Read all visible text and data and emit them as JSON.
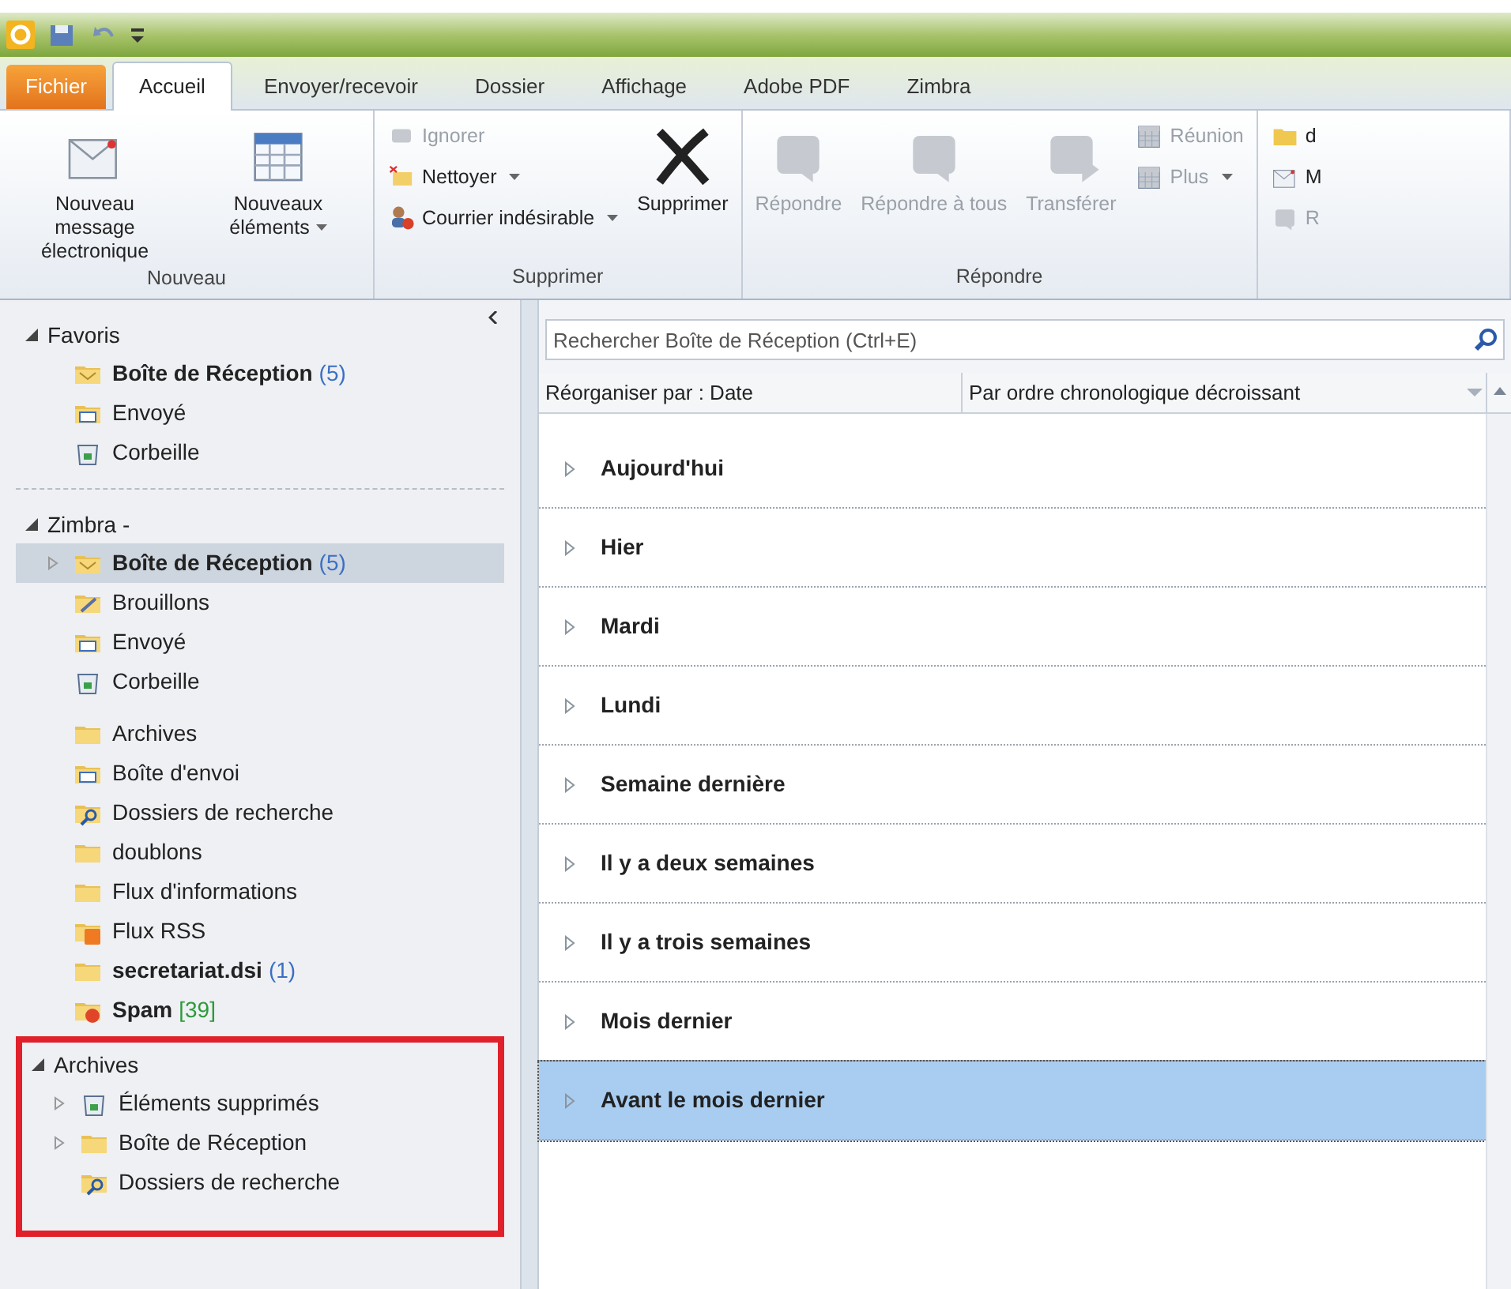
{
  "tabs": [
    {
      "label": "Fichier",
      "kind": "file",
      "selected": false
    },
    {
      "label": "Accueil",
      "kind": "tab",
      "selected": true
    },
    {
      "label": "Envoyer/recevoir",
      "kind": "tab",
      "selected": false
    },
    {
      "label": "Dossier",
      "kind": "tab",
      "selected": false
    },
    {
      "label": "Affichage",
      "kind": "tab",
      "selected": false
    },
    {
      "label": "Adobe PDF",
      "kind": "tab",
      "selected": false
    },
    {
      "label": "Zimbra",
      "kind": "tab",
      "selected": false
    }
  ],
  "ribbon": [
    {
      "label": "Nouveau",
      "buttons": [
        {
          "label": "Nouveau message électronique",
          "kind": "large",
          "disabled": false,
          "dropdown": false
        },
        {
          "label": "Nouveaux éléments",
          "kind": "large",
          "disabled": false,
          "dropdown": true
        }
      ]
    },
    {
      "label": "Supprimer",
      "buttons": [
        {
          "label": "Ignorer",
          "kind": "small",
          "disabled": true,
          "dropdown": false
        },
        {
          "label": "Nettoyer",
          "kind": "small",
          "disabled": false,
          "dropdown": true
        },
        {
          "label": "Courrier indésirable",
          "kind": "small",
          "disabled": false,
          "dropdown": true
        },
        {
          "label": "Supprimer",
          "kind": "large",
          "disabled": false,
          "dropdown": false
        }
      ]
    },
    {
      "label": "Répondre",
      "buttons": [
        {
          "label": "Répondre",
          "kind": "large",
          "disabled": true,
          "dropdown": false
        },
        {
          "label": "Répondre à tous",
          "kind": "large",
          "disabled": true,
          "dropdown": false
        },
        {
          "label": "Transférer",
          "kind": "large",
          "disabled": true,
          "dropdown": false
        },
        {
          "label": "Réunion",
          "kind": "small",
          "disabled": true,
          "dropdown": false
        },
        {
          "label": "Plus",
          "kind": "small",
          "disabled": true,
          "dropdown": true
        }
      ]
    },
    {
      "buttons": [
        {
          "label": "d",
          "kind": "small",
          "disabled": false,
          "dropdown": false
        },
        {
          "label": "M",
          "kind": "small",
          "disabled": false,
          "dropdown": false
        },
        {
          "label": "R",
          "kind": "small",
          "disabled": true,
          "dropdown": false
        }
      ]
    }
  ],
  "folder_sections": [
    {
      "title": "Favoris",
      "highlighted": false,
      "items": [
        {
          "name": "Boîte de Réception",
          "count": "(5)",
          "color": "#3b6fc4",
          "kind": "inbox",
          "bold": true,
          "selected": false
        },
        {
          "name": "Envoyé",
          "kind": "sent",
          "bold": false,
          "selected": false
        },
        {
          "name": "Corbeille",
          "kind": "trash",
          "bold": false,
          "selected": false
        }
      ]
    },
    {
      "title": "Zimbra -",
      "highlighted": false,
      "items": [
        {
          "name": "Boîte de Réception",
          "count": "(5)",
          "color": "#3b6fc4",
          "kind": "inbox",
          "bold": true,
          "selected": true,
          "expanded": false
        },
        {
          "name": "Brouillons",
          "kind": "drafts",
          "bold": false,
          "selected": false
        },
        {
          "name": "Envoyé",
          "kind": "sent",
          "bold": false,
          "selected": false
        },
        {
          "name": "Corbeille",
          "kind": "trash",
          "bold": false,
          "selected": false
        },
        {
          "name": "Archives",
          "kind": "folder",
          "bold": false,
          "selected": false
        },
        {
          "name": "Boîte d'envoi",
          "kind": "outbox",
          "bold": false,
          "selected": false
        },
        {
          "name": "Dossiers de recherche",
          "kind": "search",
          "bold": false,
          "selected": false
        },
        {
          "name": "doublons",
          "kind": "folder",
          "bold": false,
          "selected": false
        },
        {
          "name": "Flux d'informations",
          "kind": "folder",
          "bold": false,
          "selected": false
        },
        {
          "name": "Flux RSS",
          "kind": "rss",
          "bold": false,
          "selected": false
        },
        {
          "name": "secretariat.dsi",
          "count": "(1)",
          "color": "#3b6fc4",
          "kind": "folder",
          "bold": true,
          "selected": false
        },
        {
          "name": "Spam",
          "count": "[39]",
          "color": "#2e9a3a",
          "kind": "spam",
          "bold": true,
          "selected": false
        }
      ]
    },
    {
      "title": "Archives",
      "highlighted": true,
      "items": [
        {
          "name": "Éléments supprimés",
          "kind": "trash",
          "bold": false,
          "selected": false,
          "expanded": false
        },
        {
          "name": "Boîte de Réception",
          "kind": "folder",
          "bold": false,
          "selected": false,
          "expanded": false
        },
        {
          "name": "Dossiers de recherche",
          "kind": "search",
          "bold": false,
          "selected": false
        }
      ]
    }
  ],
  "search": {
    "placeholder": "Rechercher Boîte de Réception (Ctrl+E)"
  },
  "arrange": {
    "sort_by": "Réorganiser par : Date",
    "order": "Par ordre chronologique décroissant"
  },
  "mail_groups": [
    {
      "label": "Aujourd'hui",
      "selected": false
    },
    {
      "label": "Hier",
      "selected": false
    },
    {
      "label": "Mardi",
      "selected": false
    },
    {
      "label": "Lundi",
      "selected": false
    },
    {
      "label": "Semaine dernière",
      "selected": false
    },
    {
      "label": "Il y a deux semaines",
      "selected": false
    },
    {
      "label": "Il y a trois semaines",
      "selected": false
    },
    {
      "label": "Mois dernier",
      "selected": false
    },
    {
      "label": "Avant le mois dernier",
      "selected": true
    }
  ]
}
